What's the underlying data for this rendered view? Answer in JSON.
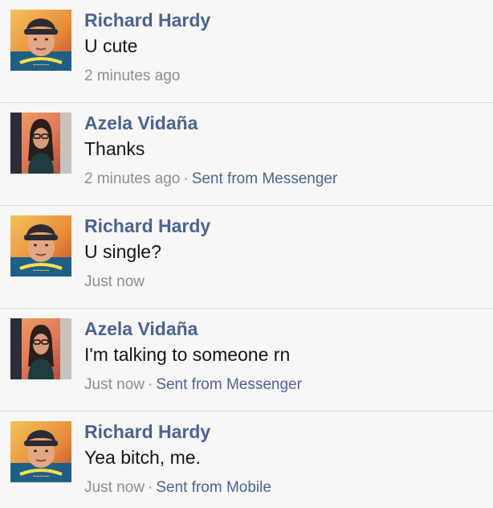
{
  "messages": [
    {
      "sender": "Richard Hardy",
      "text": "U cute",
      "time": "2 minutes ago",
      "separator": "",
      "source": "",
      "avatar": "boy-avatar"
    },
    {
      "sender": "Azela Vidaña",
      "text": "Thanks",
      "time": "2 minutes ago",
      "separator": "·",
      "source": "Sent from Messenger",
      "avatar": "girl-avatar"
    },
    {
      "sender": "Richard Hardy",
      "text": "U single?",
      "time": "Just now",
      "separator": "",
      "source": "",
      "avatar": "boy-avatar"
    },
    {
      "sender": "Azela Vidaña",
      "text": "I'm talking to someone rn",
      "time": "Just now",
      "separator": "·",
      "source": "Sent from Messenger",
      "avatar": "girl-avatar"
    },
    {
      "sender": "Richard Hardy",
      "text": "Yea bitch, me.",
      "time": "Just now",
      "separator": "·",
      "source": "Sent from Mobile",
      "avatar": "boy-avatar"
    }
  ],
  "colors": {
    "name": "#4a6391",
    "text": "#151515",
    "meta": "#8a8d91",
    "background": "#f7f7f7"
  }
}
